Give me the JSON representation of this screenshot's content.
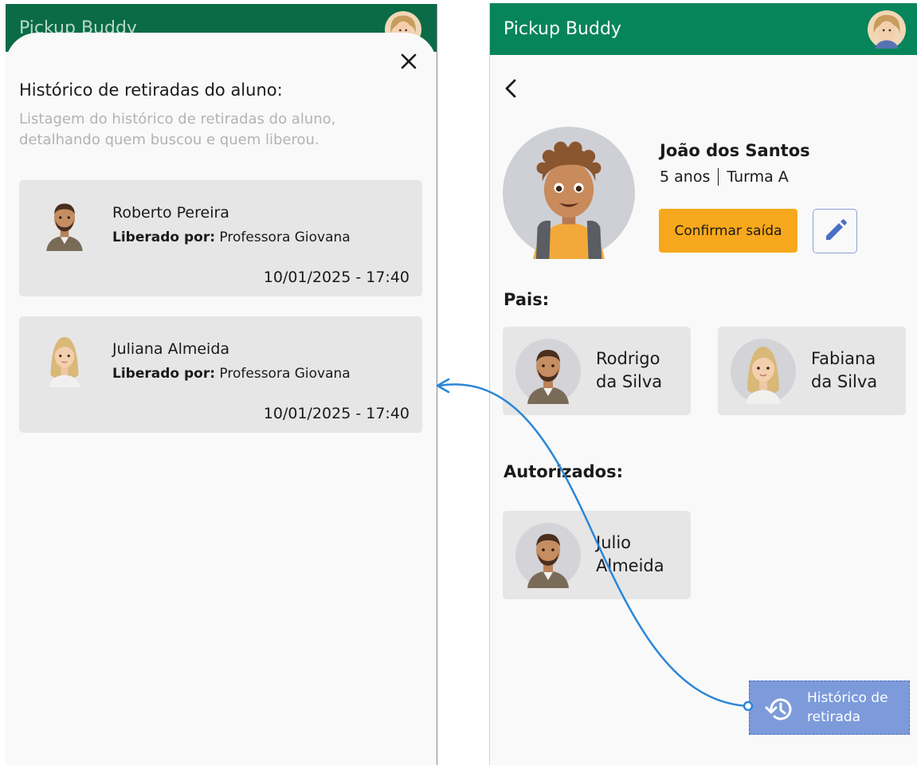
{
  "colors": {
    "appbar_dim": "#0a6b46",
    "appbar": "#07855a",
    "card_bg": "#e6e6e6",
    "confirm_button": "#f7a81c",
    "history_button": "#7d9bdb",
    "connector": "#2a86d8"
  },
  "history_screen": {
    "appbar_title": "Pickup Buddy",
    "appbar_avatar_icon": "user-avatar-icon",
    "close_icon": "close-icon",
    "title": "Histórico de retiradas do aluno:",
    "subtitle": "Listagem do histórico de retiradas do aluno, detalhando quem buscou e quem liberou.",
    "records": [
      {
        "name": "Roberto Pereira",
        "released_label": "Liberado por:",
        "released_by": "Professora Giovana",
        "datetime": "10/01/2025 - 17:40",
        "avatar_icon": "man-avatar-icon"
      },
      {
        "name": "Juliana Almeida",
        "released_label": "Liberado por:",
        "released_by": "Professora Giovana",
        "datetime": "10/01/2025 - 17:40",
        "avatar_icon": "woman-avatar-icon"
      }
    ]
  },
  "student_screen": {
    "appbar_title": "Pickup Buddy",
    "appbar_avatar_icon": "user-avatar-icon",
    "back_icon": "back-arrow-icon",
    "student": {
      "name": "João dos Santos",
      "age": "5 anos",
      "class": "Turma A",
      "avatar_icon": "child-avatar-icon"
    },
    "confirm_button": "Confirmar saída",
    "edit_icon": "pencil-icon",
    "parents_heading": "Pais:",
    "parents": [
      {
        "name": "Rodrigo da Silva",
        "avatar_icon": "man-avatar-icon"
      },
      {
        "name": "Fabiana da Silva",
        "avatar_icon": "woman-avatar-icon"
      }
    ],
    "authorized_heading": "Autorizados:",
    "authorized": [
      {
        "name": "Julio Almeida",
        "avatar_icon": "man-avatar-icon"
      }
    ],
    "history_button": "Histórico de retirada",
    "history_icon": "history-icon"
  }
}
